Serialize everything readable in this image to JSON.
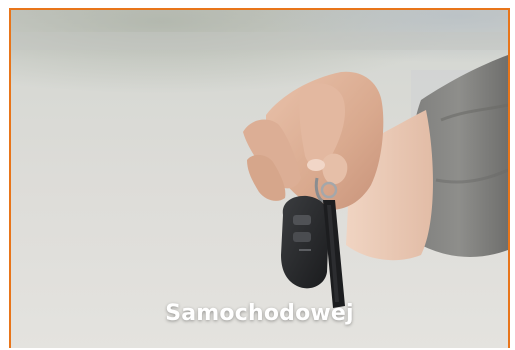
{
  "card": {
    "caption": "Samochodowej",
    "border_color": "#e8751a"
  },
  "photo": {
    "subject": "hand-holding-car-key"
  }
}
